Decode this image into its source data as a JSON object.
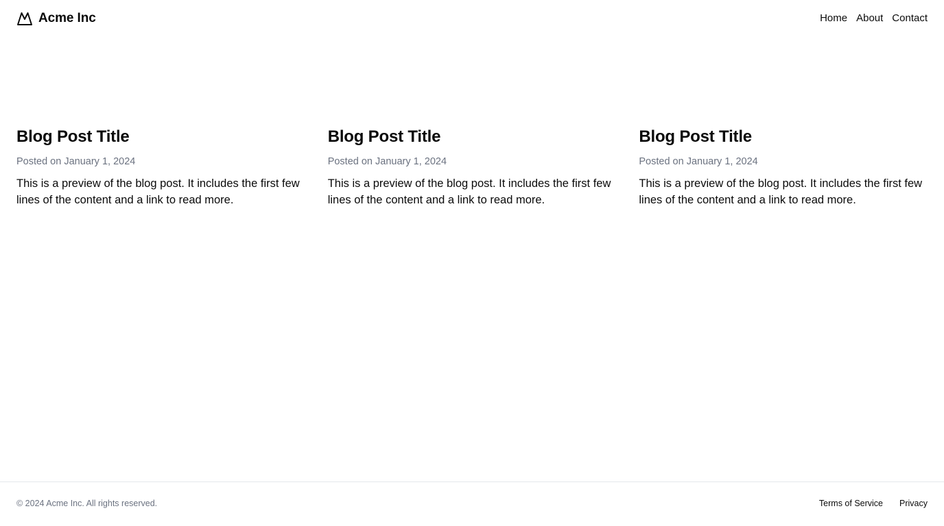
{
  "header": {
    "brand_name": "Acme Inc",
    "logo_icon": "mountain-icon",
    "nav": [
      {
        "label": "Home"
      },
      {
        "label": "About"
      },
      {
        "label": "Contact"
      }
    ]
  },
  "posts": [
    {
      "title": "Blog Post Title",
      "date": "Posted on January 1, 2024",
      "excerpt": "This is a preview of the blog post. It includes the first few lines of the content and a link to read more."
    },
    {
      "title": "Blog Post Title",
      "date": "Posted on January 1, 2024",
      "excerpt": "This is a preview of the blog post. It includes the first few lines of the content and a link to read more."
    },
    {
      "title": "Blog Post Title",
      "date": "Posted on January 1, 2024",
      "excerpt": "This is a preview of the blog post. It includes the first few lines of the content and a link to read more."
    }
  ],
  "footer": {
    "copyright": "© 2024 Acme Inc. All rights reserved.",
    "links": [
      {
        "label": "Terms of Service"
      },
      {
        "label": "Privacy"
      }
    ]
  },
  "colors": {
    "text": "#0a0a0a",
    "muted": "#6b7280",
    "border": "#e5e7eb",
    "background": "#ffffff"
  }
}
